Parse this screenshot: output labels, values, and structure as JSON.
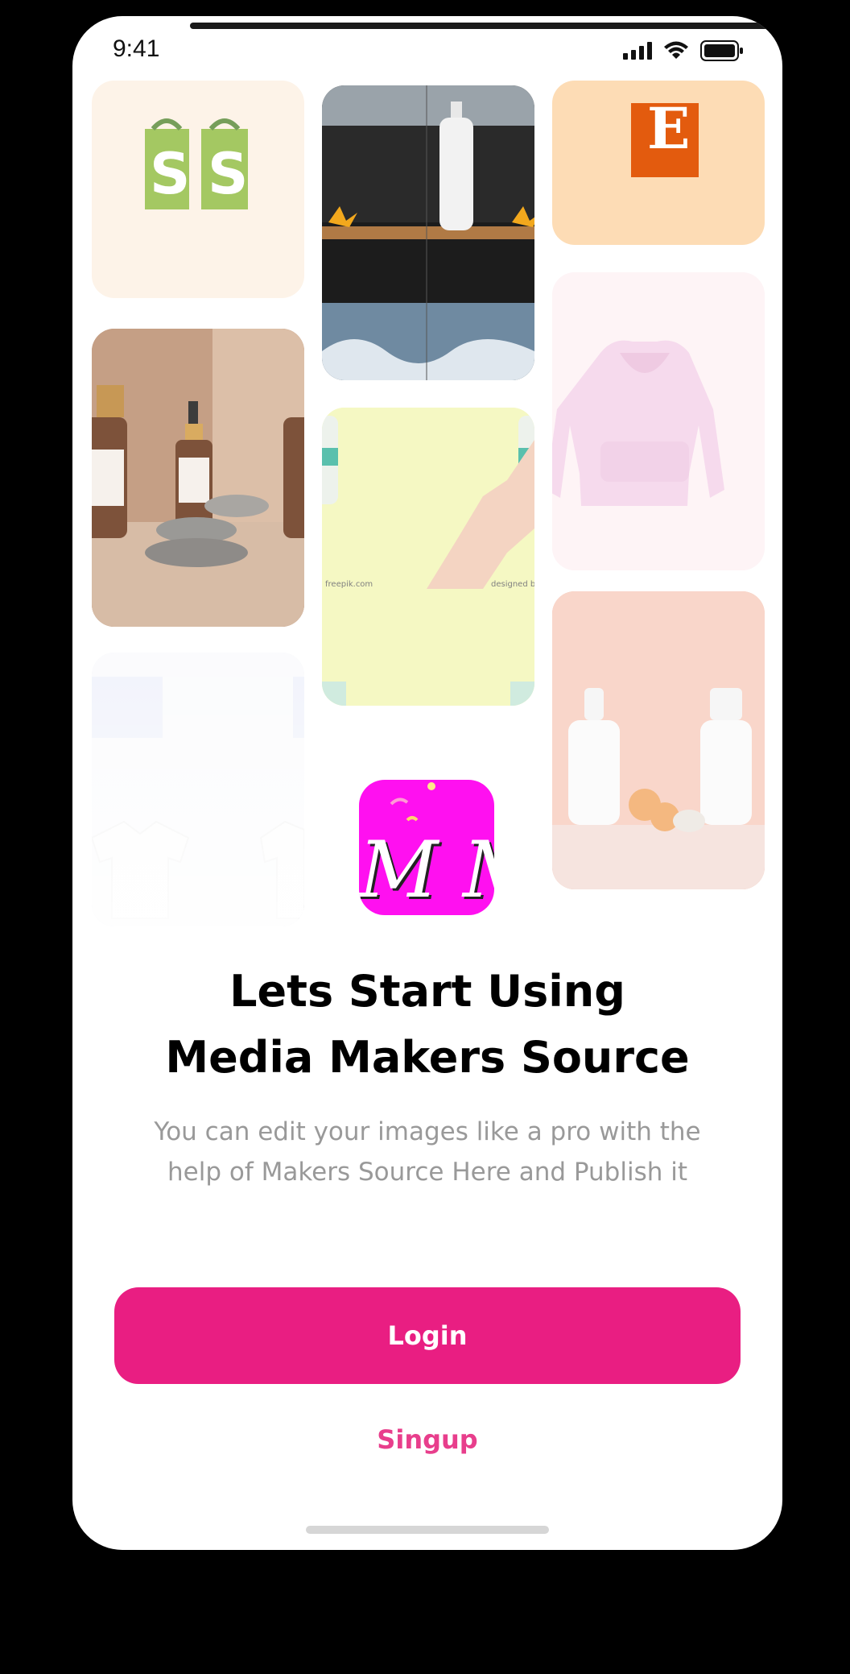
{
  "status_bar": {
    "time": "9:41"
  },
  "logo": {
    "text": "M M",
    "color": "#ff10f0"
  },
  "headline": {
    "line1": "Lets Start Using",
    "line2": "Media Makers Source"
  },
  "subtitle": {
    "line1": "You can edit your images like a pro with the",
    "line2": "help of Makers Source Here and Publish it"
  },
  "actions": {
    "login_label": "Login",
    "signup_label": "Singup"
  },
  "colors": {
    "accent": "#e91e82",
    "signup_text": "#e83e8c",
    "subtitle_text": "#999999"
  },
  "gallery": {
    "tiles": [
      {
        "id": "shopify-bags",
        "caption": ""
      },
      {
        "id": "bottle-on-stone",
        "caption": ""
      },
      {
        "id": "orange-letter-tile",
        "caption": "E"
      },
      {
        "id": "pink-hoodie",
        "caption": ""
      },
      {
        "id": "serum-bottles",
        "caption": ""
      },
      {
        "id": "hand-cream",
        "caption": "",
        "watermark_left": "freepik.com",
        "watermark_right": "designed by"
      },
      {
        "id": "white-tshirts",
        "caption": ""
      },
      {
        "id": "white-bottles-peach",
        "caption": ""
      }
    ]
  }
}
